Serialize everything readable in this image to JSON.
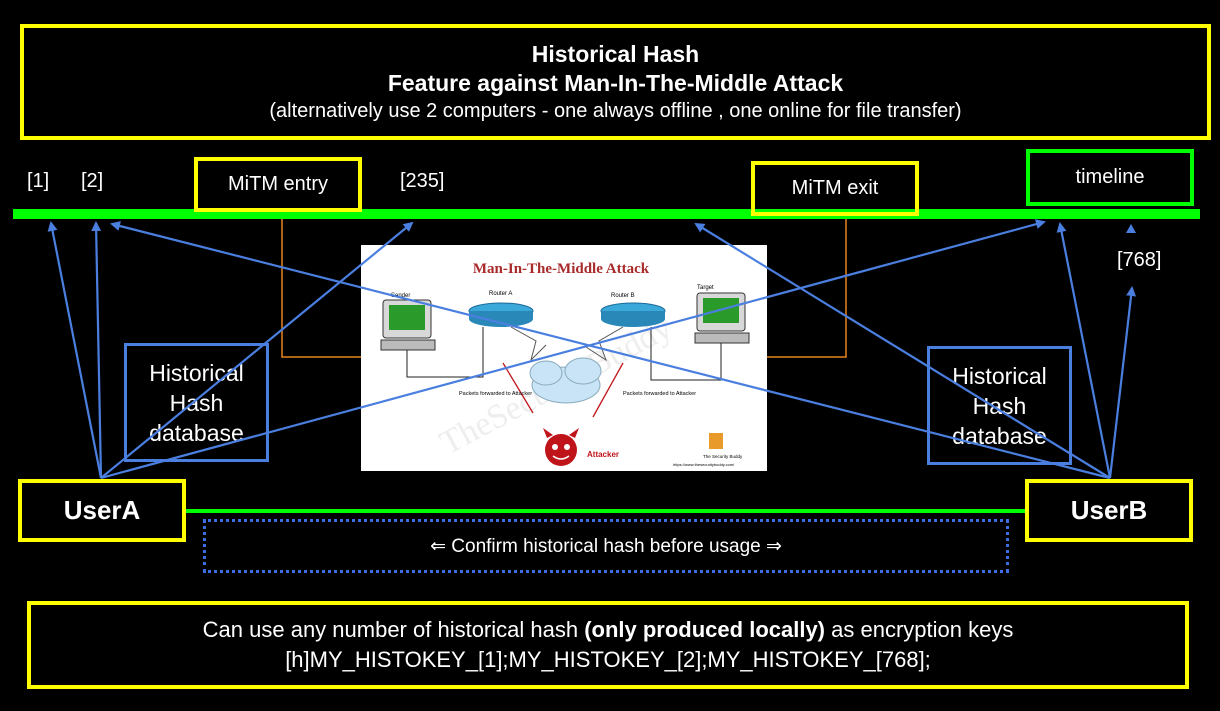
{
  "title": {
    "line1": "Historical Hash",
    "line2": "Feature against Man-In-The-Middle Attack",
    "line3": "(alternatively use 2 computers - one always  offline , one online for file transfer)"
  },
  "timeline": {
    "marker_1": "[1]",
    "marker_2": "[2]",
    "marker_235": "[235]",
    "marker_768": "[768]",
    "mitm_entry": "MiTM entry",
    "mitm_exit": "MiTM exit",
    "label": "timeline"
  },
  "hash_db_left": {
    "line1": "Historical",
    "line2": "Hash",
    "line3": "database"
  },
  "hash_db_right": {
    "line1": "Historical",
    "line2": "Hash",
    "line3": "database"
  },
  "users": {
    "a": "UserA",
    "b": "UserB"
  },
  "confirm_text": "⇐ Confirm historical hash before usage ⇒",
  "illustration": {
    "title": "Man-In-The-Middle Attack",
    "sender": "Sender",
    "router_a": "Router A",
    "router_b": "Router B",
    "target": "Target",
    "packets_left": "Packets forwarded to Attacker",
    "packets_right": "Packets forwarded to Attacker",
    "attacker": "Attacker",
    "watermark": "TheSecurityBuddy",
    "brand": "The Security Buddy",
    "url": "https://www.thesecuritybuddy.com/"
  },
  "note": {
    "line1_a": "Can use any number of historical hash ",
    "line1_b": "(only produced locally)",
    "line1_c": " as encryption  keys",
    "line2": "[h]MY_HISTOKEY_[1];MY_HISTOKEY_[2];MY_HISTOKEY_[768];"
  },
  "colors": {
    "background": "#000000",
    "yellow_border": "#ffff00",
    "green": "#00ff00",
    "blue_arrow": "#4a7fe0",
    "orange_line": "#e8821e",
    "attacker_red": "#c0141b"
  }
}
